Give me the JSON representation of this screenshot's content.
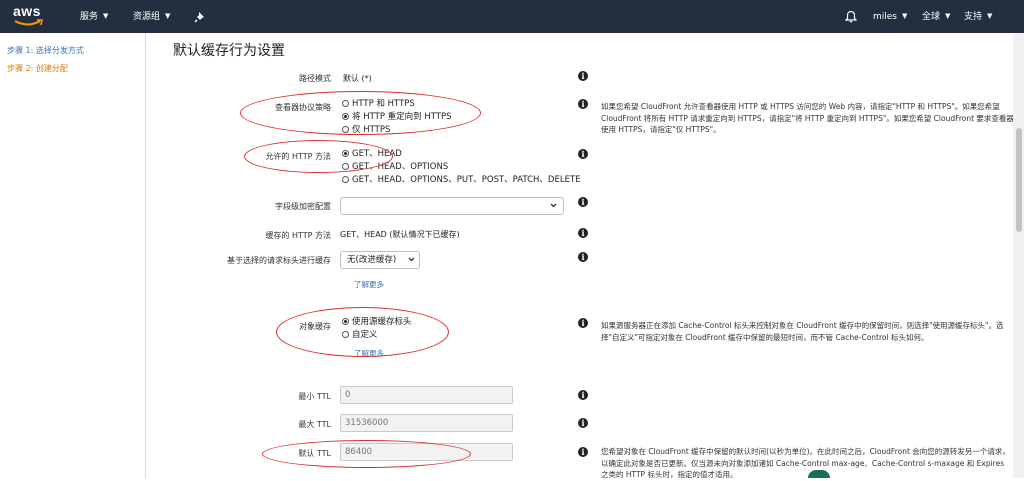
{
  "topnav": {
    "logo_text": "aws",
    "services": "服务",
    "resource_groups": "资源组",
    "user": "miles",
    "region": "全球",
    "support": "支持",
    "bg_color": "#232f3e"
  },
  "sidebar": {
    "step1": "步骤 1: 选择分发方式",
    "step2": "步骤 2: 创建分配"
  },
  "page_title": "默认缓存行为设置",
  "rows": {
    "path_pattern": {
      "label": "路径模式",
      "value": "默认 (*)"
    },
    "viewer_protocol": {
      "label": "查看器协议策略",
      "options": [
        "HTTP 和 HTTPS",
        "将 HTTP 重定向到 HTTPS",
        "仅 HTTPS"
      ],
      "selected": "将 HTTP 重定向到 HTTPS",
      "help": "如果您希望 CloudFront 允许查看器使用 HTTP 或 HTTPS 访问您的 Web 内容，请指定\"HTTP 和 HTTPS\"。如果您希望 CloudFront 将所有 HTTP 请求重定向到 HTTPS，请指定\"将 HTTP 重定向到 HTTPS\"。如果您希望 CloudFront 要求查看器使用 HTTPS，请指定\"仅 HTTPS\"。"
    },
    "allowed_methods": {
      "label": "允许的 HTTP 方法",
      "options": [
        "GET、HEAD",
        "GET、HEAD、OPTIONS",
        "GET、HEAD、OPTIONS、PUT、POST、PATCH、DELETE"
      ],
      "selected": "GET、HEAD"
    },
    "field_encryption": {
      "label": "字段级加密配置",
      "value": ""
    },
    "cached_methods": {
      "label": "缓存的 HTTP 方法",
      "value": "GET、HEAD (默认情况下已缓存)"
    },
    "cache_headers": {
      "label": "基于选择的请求标头进行缓存",
      "value": "无(改进缓存)",
      "learn_more": "了解更多"
    },
    "object_caching": {
      "label": "对象缓存",
      "options": [
        "使用源缓存标头",
        "自定义"
      ],
      "selected": "使用源缓存标头",
      "learn_more": "了解更多",
      "help": "如果源服务器正在添加 Cache-Control 标头来控制对象在 CloudFront 缓存中的保留时间，则选择\"使用源缓存标头\"。选择\"自定义\"可指定对象在 CloudFront 缓存中保留的最短时间，而不管 Cache-Control 标头如何。"
    },
    "min_ttl": {
      "label": "最小 TTL",
      "value": "0"
    },
    "max_ttl": {
      "label": "最大 TTL",
      "value": "31536000"
    },
    "default_ttl": {
      "label": "默认 TTL",
      "value": "86400",
      "help": "您希望对象在 CloudFront 缓存中保留的默认时间(以秒为单位)。在此时间之后，CloudFront 会向您的源转发另一个请求，以确定此对象是否已更新。仅当源未向对象添加诸如 Cache-Control max-age、Cache-Control s-maxage 和 Expires 之类的 HTTP 标头时，指定的值才适用。"
    }
  },
  "colors": {
    "annotation": "#d9302c",
    "link": "#3a72b5",
    "active_step": "#e07b00"
  }
}
